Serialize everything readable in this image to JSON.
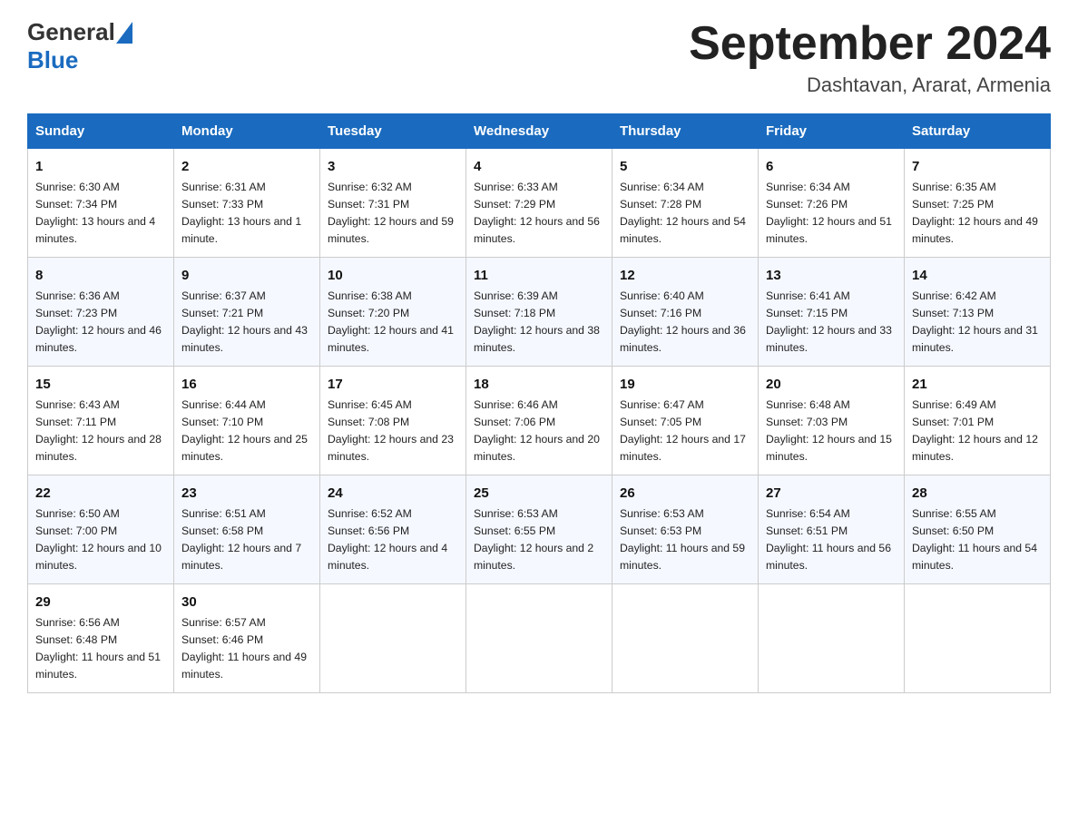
{
  "header": {
    "month_year": "September 2024",
    "location": "Dashtavan, Ararat, Armenia",
    "logo_general": "General",
    "logo_blue": "Blue"
  },
  "days_of_week": [
    "Sunday",
    "Monday",
    "Tuesday",
    "Wednesday",
    "Thursday",
    "Friday",
    "Saturday"
  ],
  "weeks": [
    [
      {
        "day": "1",
        "sunrise": "6:30 AM",
        "sunset": "7:34 PM",
        "daylight": "13 hours and 4 minutes."
      },
      {
        "day": "2",
        "sunrise": "6:31 AM",
        "sunset": "7:33 PM",
        "daylight": "13 hours and 1 minute."
      },
      {
        "day": "3",
        "sunrise": "6:32 AM",
        "sunset": "7:31 PM",
        "daylight": "12 hours and 59 minutes."
      },
      {
        "day": "4",
        "sunrise": "6:33 AM",
        "sunset": "7:29 PM",
        "daylight": "12 hours and 56 minutes."
      },
      {
        "day": "5",
        "sunrise": "6:34 AM",
        "sunset": "7:28 PM",
        "daylight": "12 hours and 54 minutes."
      },
      {
        "day": "6",
        "sunrise": "6:34 AM",
        "sunset": "7:26 PM",
        "daylight": "12 hours and 51 minutes."
      },
      {
        "day": "7",
        "sunrise": "6:35 AM",
        "sunset": "7:25 PM",
        "daylight": "12 hours and 49 minutes."
      }
    ],
    [
      {
        "day": "8",
        "sunrise": "6:36 AM",
        "sunset": "7:23 PM",
        "daylight": "12 hours and 46 minutes."
      },
      {
        "day": "9",
        "sunrise": "6:37 AM",
        "sunset": "7:21 PM",
        "daylight": "12 hours and 43 minutes."
      },
      {
        "day": "10",
        "sunrise": "6:38 AM",
        "sunset": "7:20 PM",
        "daylight": "12 hours and 41 minutes."
      },
      {
        "day": "11",
        "sunrise": "6:39 AM",
        "sunset": "7:18 PM",
        "daylight": "12 hours and 38 minutes."
      },
      {
        "day": "12",
        "sunrise": "6:40 AM",
        "sunset": "7:16 PM",
        "daylight": "12 hours and 36 minutes."
      },
      {
        "day": "13",
        "sunrise": "6:41 AM",
        "sunset": "7:15 PM",
        "daylight": "12 hours and 33 minutes."
      },
      {
        "day": "14",
        "sunrise": "6:42 AM",
        "sunset": "7:13 PM",
        "daylight": "12 hours and 31 minutes."
      }
    ],
    [
      {
        "day": "15",
        "sunrise": "6:43 AM",
        "sunset": "7:11 PM",
        "daylight": "12 hours and 28 minutes."
      },
      {
        "day": "16",
        "sunrise": "6:44 AM",
        "sunset": "7:10 PM",
        "daylight": "12 hours and 25 minutes."
      },
      {
        "day": "17",
        "sunrise": "6:45 AM",
        "sunset": "7:08 PM",
        "daylight": "12 hours and 23 minutes."
      },
      {
        "day": "18",
        "sunrise": "6:46 AM",
        "sunset": "7:06 PM",
        "daylight": "12 hours and 20 minutes."
      },
      {
        "day": "19",
        "sunrise": "6:47 AM",
        "sunset": "7:05 PM",
        "daylight": "12 hours and 17 minutes."
      },
      {
        "day": "20",
        "sunrise": "6:48 AM",
        "sunset": "7:03 PM",
        "daylight": "12 hours and 15 minutes."
      },
      {
        "day": "21",
        "sunrise": "6:49 AM",
        "sunset": "7:01 PM",
        "daylight": "12 hours and 12 minutes."
      }
    ],
    [
      {
        "day": "22",
        "sunrise": "6:50 AM",
        "sunset": "7:00 PM",
        "daylight": "12 hours and 10 minutes."
      },
      {
        "day": "23",
        "sunrise": "6:51 AM",
        "sunset": "6:58 PM",
        "daylight": "12 hours and 7 minutes."
      },
      {
        "day": "24",
        "sunrise": "6:52 AM",
        "sunset": "6:56 PM",
        "daylight": "12 hours and 4 minutes."
      },
      {
        "day": "25",
        "sunrise": "6:53 AM",
        "sunset": "6:55 PM",
        "daylight": "12 hours and 2 minutes."
      },
      {
        "day": "26",
        "sunrise": "6:53 AM",
        "sunset": "6:53 PM",
        "daylight": "11 hours and 59 minutes."
      },
      {
        "day": "27",
        "sunrise": "6:54 AM",
        "sunset": "6:51 PM",
        "daylight": "11 hours and 56 minutes."
      },
      {
        "day": "28",
        "sunrise": "6:55 AM",
        "sunset": "6:50 PM",
        "daylight": "11 hours and 54 minutes."
      }
    ],
    [
      {
        "day": "29",
        "sunrise": "6:56 AM",
        "sunset": "6:48 PM",
        "daylight": "11 hours and 51 minutes."
      },
      {
        "day": "30",
        "sunrise": "6:57 AM",
        "sunset": "6:46 PM",
        "daylight": "11 hours and 49 minutes."
      },
      null,
      null,
      null,
      null,
      null
    ]
  ]
}
